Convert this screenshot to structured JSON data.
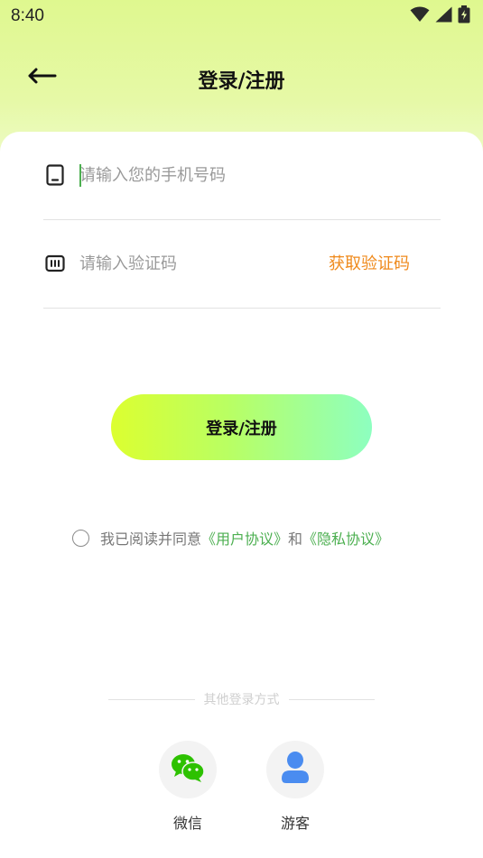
{
  "status_bar": {
    "time": "8:40",
    "icons": [
      "wifi-icon",
      "signal-icon",
      "battery-charging-icon"
    ]
  },
  "header": {
    "back_icon": "arrow-left-icon",
    "title": "登录/注册"
  },
  "form": {
    "phone": {
      "icon": "phone-icon",
      "placeholder": "请输入您的手机号码",
      "value": ""
    },
    "code": {
      "icon": "code-icon",
      "placeholder": "请输入验证码",
      "value": "",
      "get_code_label": "获取验证码"
    },
    "submit_label": "登录/注册"
  },
  "agreement": {
    "prefix": "我已阅读并同意",
    "user_agreement": "《用户协议》",
    "and": "和",
    "privacy_policy": "《隐私协议》",
    "checked": false
  },
  "alt_login": {
    "title": "其他登录方式",
    "options": [
      {
        "label": "微信",
        "icon": "wechat-icon"
      },
      {
        "label": "游客",
        "icon": "user-icon"
      }
    ]
  },
  "colors": {
    "accent_green": "#4caf50",
    "get_code_orange": "#ef8a1c",
    "button_gradient_start": "#dcff30",
    "button_gradient_end": "#8dffc0",
    "header_bg": "#dff88f",
    "wechat_green": "#2dc100",
    "guest_blue": "#4a8cf0"
  }
}
